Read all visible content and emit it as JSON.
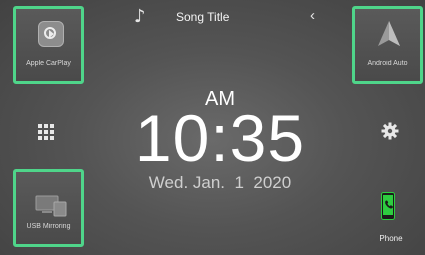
{
  "header": {
    "song_title": "Song Title",
    "note_icon": "music-note-icon",
    "back_icon": "chevron-left-icon"
  },
  "tiles": {
    "carplay_label": "Apple CarPlay",
    "android_label": "Android Auto",
    "usb_label": "USB Mirroring"
  },
  "clock": {
    "ampm": "AM",
    "time": "10:35",
    "date": "Wed. Jan.  1  2020"
  },
  "side": {
    "menu_icon": "grid-menu-icon",
    "settings_icon": "gear-icon"
  },
  "phone": {
    "label": "Phone",
    "icon": "phone-icon"
  },
  "colors": {
    "tile_border": "#4fd58a",
    "phone_accent": "#2ecc40"
  }
}
